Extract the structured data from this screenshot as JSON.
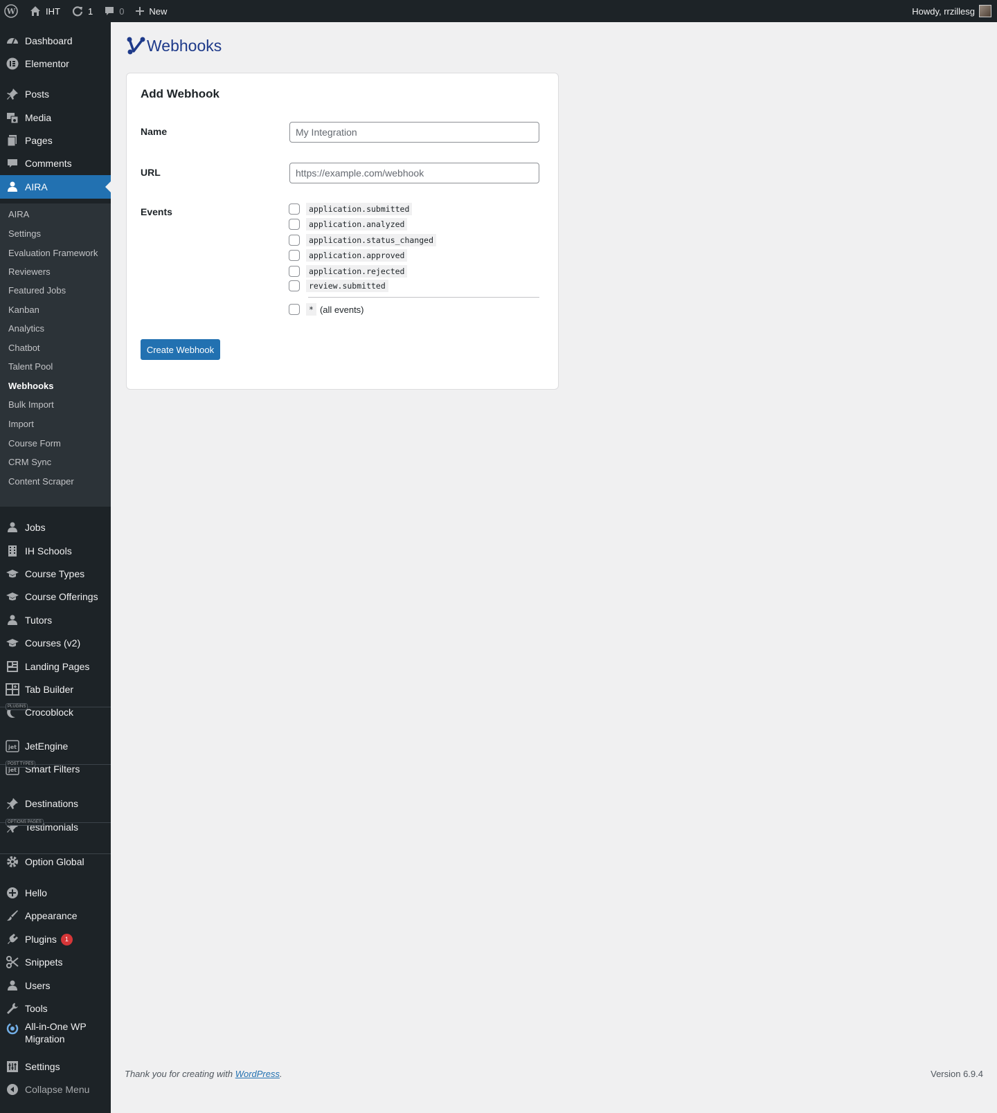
{
  "adminbar": {
    "site_name": "IHT",
    "updates_count": "1",
    "comments_count": "0",
    "new_label": "New",
    "howdy": "Howdy, rrzillesg"
  },
  "sidebar": {
    "top_items": [
      {
        "label": "Dashboard",
        "icon": "dashboard-icon"
      },
      {
        "label": "Elementor",
        "icon": "elementor-icon"
      },
      {
        "label": "Posts",
        "icon": "pin-icon"
      },
      {
        "label": "Media",
        "icon": "media-icon"
      },
      {
        "label": "Pages",
        "icon": "pages-icon"
      },
      {
        "label": "Comments",
        "icon": "comment-icon"
      },
      {
        "label": "AIRA",
        "icon": "user-icon"
      }
    ],
    "aira_submenu": [
      "AIRA",
      "Settings",
      "Evaluation Framework",
      "Reviewers",
      "Featured Jobs",
      "Kanban",
      "Analytics",
      "Chatbot",
      "Talent Pool",
      "Webhooks",
      "Bulk Import",
      "Import",
      "Course Form",
      "CRM Sync",
      "Content Scraper"
    ],
    "mid_items": [
      {
        "label": "Jobs",
        "icon": "user-icon"
      },
      {
        "label": "IH Schools",
        "icon": "building-icon"
      },
      {
        "label": "Course Types",
        "icon": "graduation-cap-icon"
      },
      {
        "label": "Course Offerings",
        "icon": "graduation-cap-icon"
      },
      {
        "label": "Tutors",
        "icon": "user-icon"
      },
      {
        "label": "Courses (v2)",
        "icon": "graduation-cap-icon"
      },
      {
        "label": "Landing Pages",
        "icon": "layout-icon"
      },
      {
        "label": "Tab Builder",
        "icon": "grid-plus-icon"
      },
      {
        "label": "Crocoblock",
        "icon": "crocoblock-icon"
      }
    ],
    "section_plugins": "PLUGINS",
    "plugin_items": [
      {
        "label": "JetEngine",
        "icon": "jet-icon"
      },
      {
        "label": "Smart Filters",
        "icon": "jet-icon"
      }
    ],
    "section_post_types": "POST TYPES",
    "post_type_items": [
      {
        "label": "Destinations",
        "icon": "pin-icon"
      },
      {
        "label": "Testimonials",
        "icon": "pin-icon"
      }
    ],
    "section_options": "OPTIONS PAGES",
    "option_items": [
      {
        "label": "Option Global",
        "icon": "gear-icon"
      }
    ],
    "bottom_items": [
      {
        "label": "Hello",
        "icon": "plus-circle-icon"
      },
      {
        "label": "Appearance",
        "icon": "brush-icon"
      },
      {
        "label": "Plugins",
        "icon": "plug-icon",
        "badge": "1"
      },
      {
        "label": "Snippets",
        "icon": "scissors-icon"
      },
      {
        "label": "Users",
        "icon": "user-icon"
      },
      {
        "label": "Tools",
        "icon": "wrench-icon"
      },
      {
        "label_line1": "All-in-One WP",
        "label_line2": "Migration",
        "icon": "migration-icon"
      },
      {
        "label": "Settings",
        "icon": "settings-icon"
      }
    ],
    "collapse_label": "Collapse Menu"
  },
  "page": {
    "title": "Webhooks",
    "card_title": "Add Webhook",
    "name_label": "Name",
    "name_placeholder": "My Integration",
    "url_label": "URL",
    "url_placeholder": "https://example.com/webhook",
    "events_label": "Events",
    "events": [
      "application.submitted",
      "application.analyzed",
      "application.status_changed",
      "application.approved",
      "application.rejected",
      "review.submitted"
    ],
    "all_events_code": "*",
    "all_events_label": "(all events)",
    "submit_label": "Create Webhook"
  },
  "footer": {
    "thanks_prefix": "Thank you for creating with ",
    "wp_link": "WordPress",
    "thanks_suffix": ".",
    "version": "Version 6.9.4"
  },
  "colors": {
    "accent": "#2271b1",
    "sidebar_bg": "#1d2327",
    "submenu_bg": "#2c3338",
    "badge": "#d63638",
    "title_blue": "#1e3a8a"
  }
}
